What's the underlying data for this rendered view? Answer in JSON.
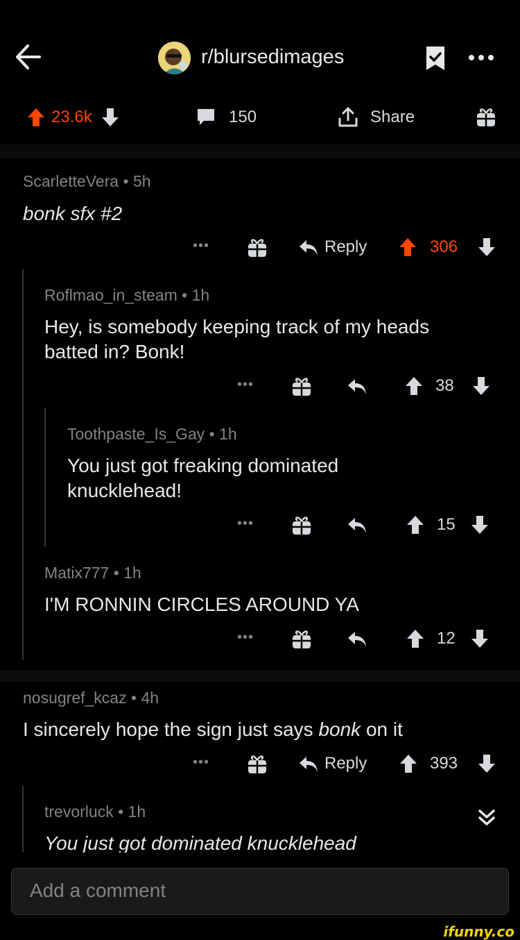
{
  "header": {
    "subreddit": "r/blursedimages"
  },
  "actionbar": {
    "score": "23.6k",
    "comments": "150",
    "share_label": "Share"
  },
  "comments": [
    {
      "user": "ScarletteVera",
      "age": "5h",
      "body": "bonk sfx #2",
      "reply_label": "Reply",
      "score": "306"
    },
    {
      "user": "Roflmao_in_steam",
      "age": "1h",
      "body_line1": "Hey, is somebody keeping track of my heads",
      "body_line2": "batted in? Bonk!",
      "score": "38"
    },
    {
      "user": "Toothpaste_Is_Gay",
      "age": "1h",
      "body_line1": "You just got freaking dominated",
      "body_line2": "knucklehead!",
      "score": "15"
    },
    {
      "user": "Matix777",
      "age": "1h",
      "body": "I'M RONNIN CIRCLES AROUND YA",
      "score": "12"
    },
    {
      "user": "nosugref_kcaz",
      "age": "4h",
      "body_pre": "I sincerely hope the sign just says ",
      "body_em": "bonk",
      "body_post": " on it",
      "reply_label": "Reply",
      "score": "393"
    },
    {
      "user": "trevorluck",
      "age": "1h",
      "body": "You just got dominated knucklehead"
    }
  ],
  "composer": {
    "placeholder": "Add a comment"
  },
  "watermark": "ifunny.co",
  "colors": {
    "upvote": "#ff4500",
    "background": "#000000",
    "meta": "#818384"
  },
  "icons": [
    "back-arrow-icon",
    "bookmark-icon",
    "more-icon",
    "upvote-icon",
    "downvote-icon",
    "comment-icon",
    "share-icon",
    "gift-icon",
    "reply-icon",
    "collapse-icon"
  ]
}
